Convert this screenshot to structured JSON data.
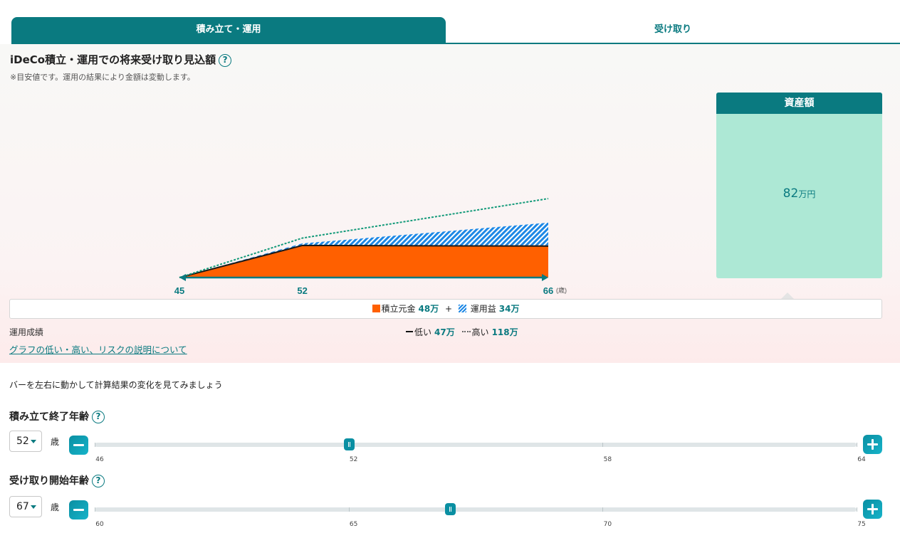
{
  "tabs": {
    "active": "積み立て・運用",
    "inactive": "受け取り"
  },
  "header": {
    "title": "iDeCo積立・運用での将来受け取り見込額",
    "help_icon": "?",
    "note": "※目安値です。運用の結果により金額は変動します。"
  },
  "chart_data": {
    "type": "area",
    "x_ticks": [
      "45",
      "52",
      "66"
    ],
    "x_unit": "(歳)",
    "x": [
      45,
      52,
      66
    ],
    "xlim": [
      45,
      66
    ],
    "series": [
      {
        "name": "積立元金",
        "color": "#ff6000",
        "values": [
          0,
          48,
          48
        ]
      },
      {
        "name": "運用益",
        "color": "#1e88e5",
        "values": [
          0,
          3,
          34
        ]
      }
    ],
    "range_lines": [
      {
        "name": "低い",
        "values": [
          0,
          48,
          47
        ]
      },
      {
        "name": "高い",
        "values": [
          0,
          59,
          118
        ]
      }
    ]
  },
  "asset": {
    "title": "資産額",
    "value": "82",
    "unit": "万円"
  },
  "legend": {
    "principal_label": "積立元金",
    "principal_value": "48万",
    "plus": "+",
    "gain_label": "運用益",
    "gain_value": "34万"
  },
  "performance": {
    "label": "運用成績",
    "low_label": "低い",
    "low_value": "47万",
    "high_label": "高い",
    "high_value": "118万",
    "link": "グラフの低い・高い、リスクの説明について"
  },
  "instruction": "バーを左右に動かして計算結果の変化を見てみましょう",
  "sliders": [
    {
      "title": "積み立て終了年齢",
      "selected": "52",
      "unit": "歳",
      "min": 46,
      "max": 64,
      "value": 52,
      "tick_values": [
        46,
        52,
        58,
        64
      ],
      "tick_labels": [
        "46",
        "52",
        "58",
        "64"
      ]
    },
    {
      "title": "受け取り開始年齢",
      "selected": "67",
      "unit": "歳",
      "min": 60,
      "max": 75,
      "value": 67,
      "tick_values": [
        60,
        65,
        70,
        75
      ],
      "tick_labels": [
        "60",
        "65",
        "70",
        "75"
      ]
    }
  ]
}
